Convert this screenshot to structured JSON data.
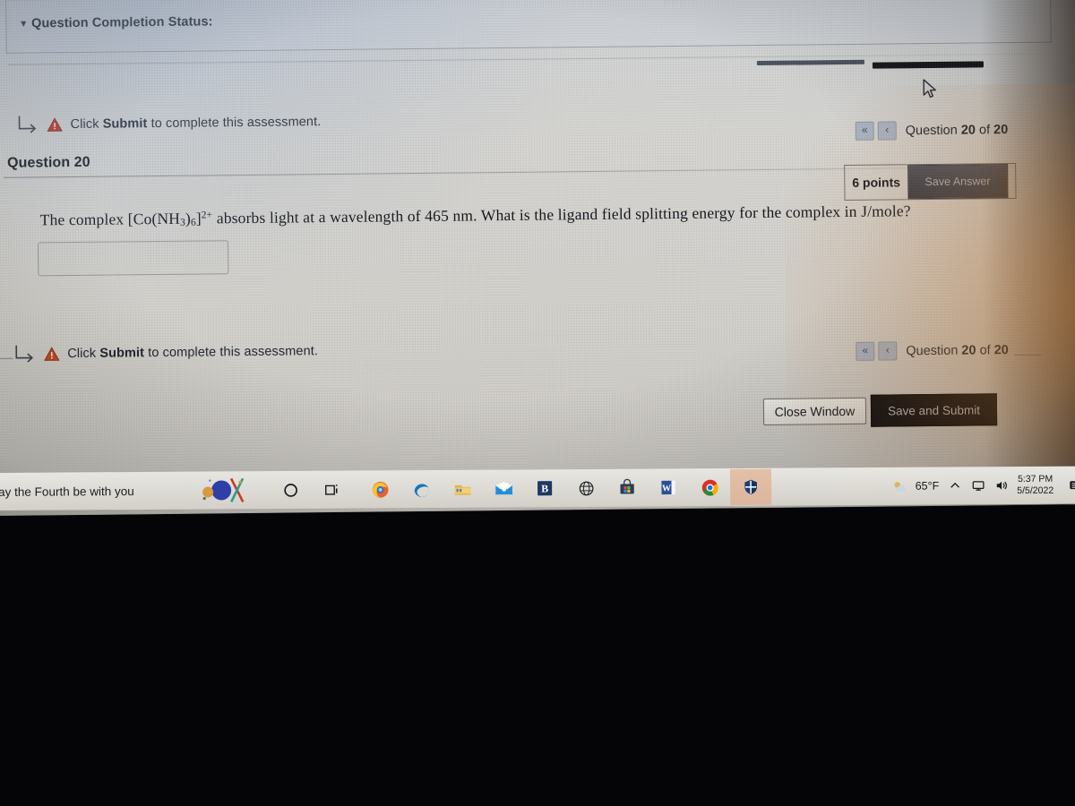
{
  "page": {
    "status_bar": {
      "caret_icon": "caret-down-icon",
      "label": "Question Completion Status:"
    },
    "notices": [
      {
        "arrow_icon": "corner-arrow-icon",
        "warning_icon": "warning-triangle-icon",
        "prefix": "Click ",
        "emphasis": "Submit",
        "suffix": " to complete this assessment."
      },
      {
        "arrow_icon": "corner-arrow-icon",
        "warning_icon": "warning-triangle-icon",
        "prefix": "Click ",
        "emphasis": "Submit",
        "suffix": " to complete this assessment."
      }
    ],
    "question": {
      "heading": "Question 20",
      "text_part_1": "The complex [Co(NH",
      "sub_1": "3",
      "text_part_2": ")",
      "sub_2": "6",
      "text_part_3": "]",
      "sup_1": "2+",
      "text_part_4": " absorbs light at a wavelength of 465 nm.  What is the ligand field splitting energy for the complex in J/mole?",
      "answer_value": "",
      "answer_placeholder": ""
    },
    "points": {
      "label": "6 points",
      "save_answer_label": "Save Answer"
    },
    "pagination_top": {
      "first_icon": "double-chevron-left-icon",
      "prev_icon": "chevron-left-icon",
      "prefix": "Question ",
      "current": "20",
      "middle": " of ",
      "total": "20"
    },
    "pagination_bottom": {
      "first_icon": "double-chevron-left-icon",
      "prev_icon": "chevron-left-icon",
      "prefix": "Question ",
      "current": "20",
      "middle": " of ",
      "total": "20"
    },
    "actions": {
      "close_window": "Close Window",
      "save_and_submit": "Save and Submit"
    }
  },
  "taskbar": {
    "news_text": "ay the Fourth be with you",
    "widget_icon": "google-doodle-icon",
    "search_icon": "circle-search-icon",
    "task_view_icon": "task-view-icon",
    "apps": [
      {
        "name": "firefox-icon",
        "label": "Firefox"
      },
      {
        "name": "edge-icon",
        "label": "Microsoft Edge"
      },
      {
        "name": "file-explorer-icon",
        "label": "File Explorer"
      },
      {
        "name": "mail-icon",
        "label": "Mail"
      },
      {
        "name": "blackboard-icon",
        "label": "B"
      },
      {
        "name": "globe-icon",
        "label": "Network"
      },
      {
        "name": "store-icon",
        "label": "Microsoft Store"
      },
      {
        "name": "word-icon",
        "label": "W"
      },
      {
        "name": "chrome-icon",
        "label": "Google Chrome"
      },
      {
        "name": "windows-security-icon",
        "label": "Windows Security"
      }
    ],
    "tray": {
      "weather_icon": "weather-icon",
      "temperature": "65°F",
      "chevron_up_icon": "chevron-up-icon",
      "network_icon": "network-monitor-icon",
      "volume_icon": "volume-icon",
      "time": "5:37 PM",
      "date": "5/5/2022",
      "notifications_icon": "notification-center-icon"
    }
  },
  "cursor": {
    "icon": "mouse-pointer-icon"
  },
  "colors": {
    "warning_red": "#c0392b",
    "blackboard_navy": "#1f3864",
    "submit_dark": "#0c0d10",
    "pager_blue": "#aab5c6"
  }
}
